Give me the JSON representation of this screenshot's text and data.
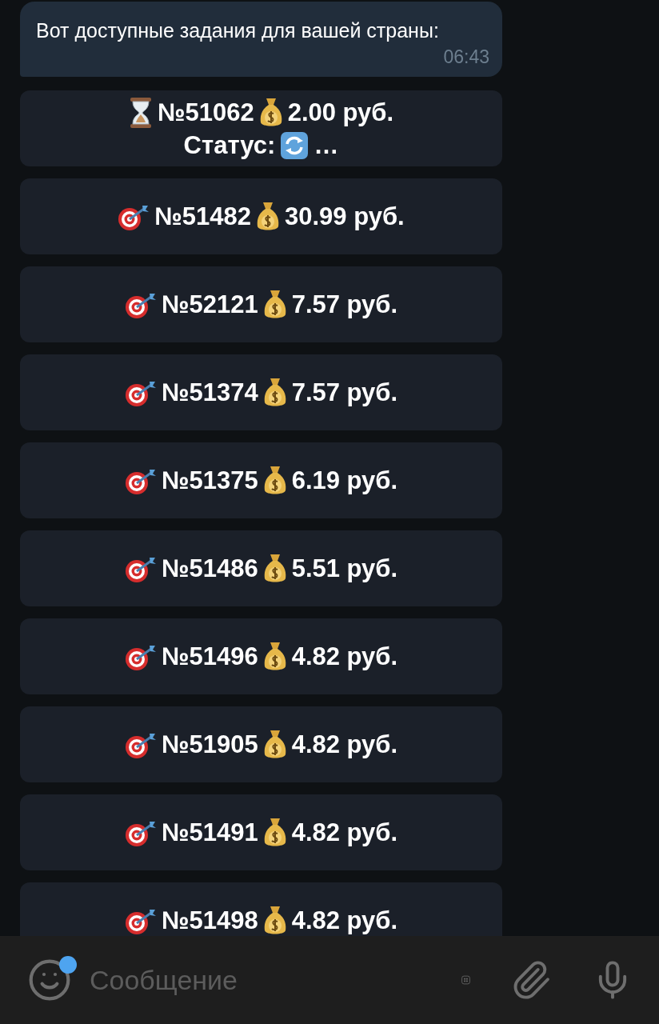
{
  "message": {
    "text": "Вот доступные задания для вашей страны:",
    "time": "06:43"
  },
  "tasks": [
    {
      "kind": "pending",
      "number": "№51062",
      "amount": "2.00 руб.",
      "status_label": "Статус:",
      "status_suffix": "…"
    },
    {
      "kind": "target",
      "number": "№51482",
      "amount": "30.99 руб."
    },
    {
      "kind": "target",
      "number": "№52121",
      "amount": "7.57 руб."
    },
    {
      "kind": "target",
      "number": "№51374",
      "amount": "7.57 руб."
    },
    {
      "kind": "target",
      "number": "№51375",
      "amount": "6.19 руб."
    },
    {
      "kind": "target",
      "number": "№51486",
      "amount": "5.51 руб."
    },
    {
      "kind": "target",
      "number": "№51496",
      "amount": "4.82 руб."
    },
    {
      "kind": "target",
      "number": "№51905",
      "amount": "4.82 руб."
    },
    {
      "kind": "target",
      "number": "№51491",
      "amount": "4.82 руб."
    },
    {
      "kind": "target",
      "number": "№51498",
      "amount": "4.82 руб."
    }
  ],
  "composer": {
    "placeholder": "Сообщение"
  }
}
